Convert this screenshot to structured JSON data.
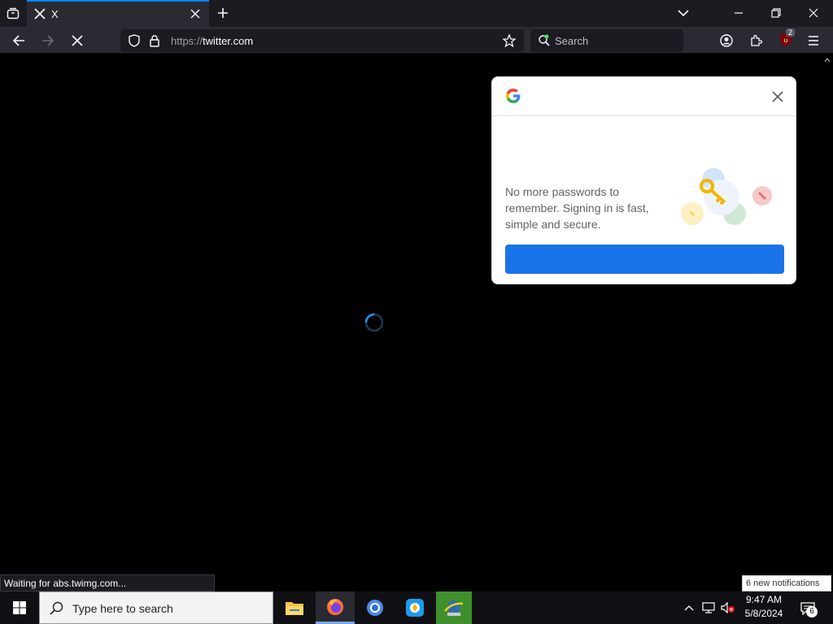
{
  "browser": {
    "tab": {
      "title": "X",
      "icon": "x-logo-icon"
    },
    "url": {
      "scheme": "https://",
      "host": "twitter.com"
    },
    "search_placeholder": "Search",
    "extension_badge": "2",
    "status_text": "Waiting for abs.twimg.com..."
  },
  "google_popup": {
    "logo": "google-g-icon",
    "message": "No more passwords to remember. Signing in is fast, simple and secure.",
    "button_label": ""
  },
  "notification": {
    "text": "6 new notifications"
  },
  "taskbar": {
    "search_placeholder": "Type here to search",
    "apps": [
      "file-explorer-icon",
      "firefox-icon",
      "chrome-icon",
      "app-icon",
      "network-app-icon"
    ],
    "time": "9:47 AM",
    "date": "5/8/2024",
    "notification_count": "6"
  },
  "colors": {
    "accent": "#0a84ff",
    "google_blue": "#1a73e8",
    "spinner": "#1d9bf0"
  }
}
